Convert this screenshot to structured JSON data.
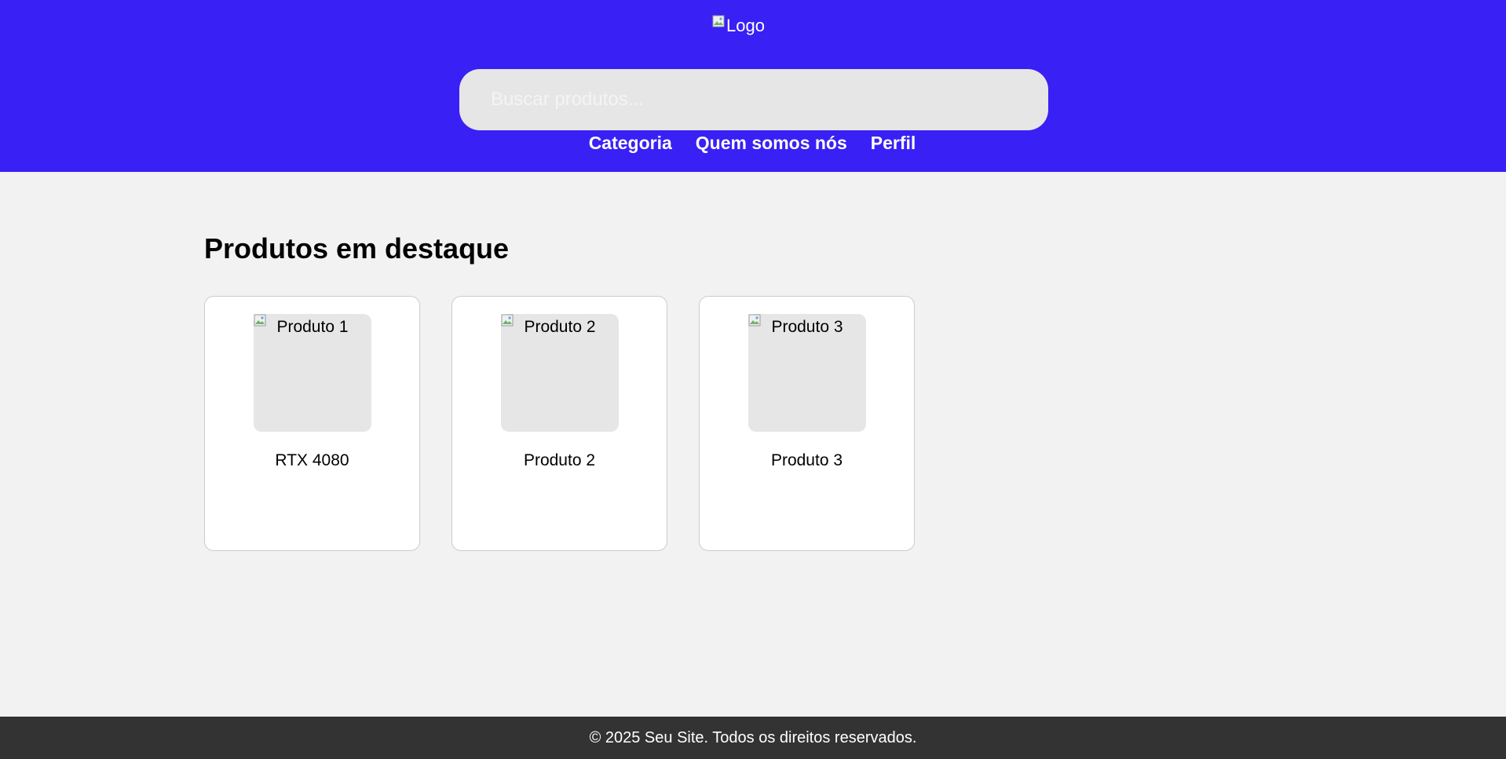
{
  "header": {
    "logo_alt": "Logo",
    "logo_icon": "broken-image-icon",
    "search_placeholder": "Buscar produtos...",
    "nav": [
      {
        "label": "Categoria"
      },
      {
        "label": "Quem somos nós"
      },
      {
        "label": "Perfil"
      }
    ],
    "background_color": "#3920f5"
  },
  "main": {
    "title": "Produtos em destaque",
    "products": [
      {
        "image_alt": "Produto 1",
        "name": "RTX 4080"
      },
      {
        "image_alt": "Produto 2",
        "name": "Produto 2"
      },
      {
        "image_alt": "Produto 3",
        "name": "Produto 3"
      }
    ]
  },
  "footer": {
    "text": "© 2025 Seu Site. Todos os direitos reservados."
  }
}
